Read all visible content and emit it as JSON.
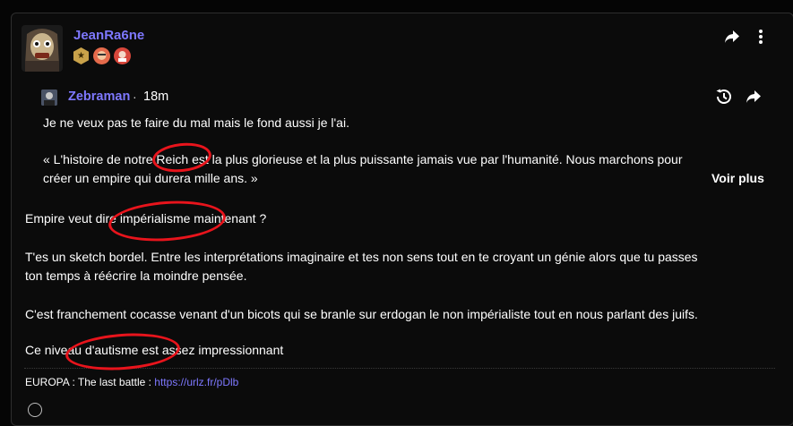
{
  "post": {
    "author": "JeanRa6ne",
    "badges": [
      "star-badge-icon",
      "face-badge-icon",
      "red-badge-icon"
    ]
  },
  "quote": {
    "author": "Zebraman",
    "separator": "·",
    "time": "18m",
    "line1": "Je ne veux pas te faire du mal mais le fond aussi je l'ai.",
    "line2": "« L'histoire de notre Reich est la plus glorieuse et la plus puissante jamais vue par l'humanité. Nous marchons pour",
    "line3": "créer un empire qui durera mille ans. »",
    "see_more": "Voir plus"
  },
  "body": {
    "p1": "Empire veut dire impérialisme maintenant ?",
    "p2a": "T'es un sketch bordel. Entre les interprétations imaginaire et tes non sens tout en te croyant un génie alors que tu passes",
    "p2b": "ton temps à réécrire la moindre pensée.",
    "p3": "C'est franchement cocasse venant d'un bicots qui se branle sur erdogan le non impérialiste tout en nous parlant des juifs.",
    "p4": "Ce niveau d'autisme est assez impressionnant"
  },
  "signature": {
    "text": "EUROPA : The last battle : ",
    "link": "https://urlz.fr/pDlb"
  },
  "colors": {
    "accent": "#7e78ff",
    "highlight": "#e8141c"
  }
}
